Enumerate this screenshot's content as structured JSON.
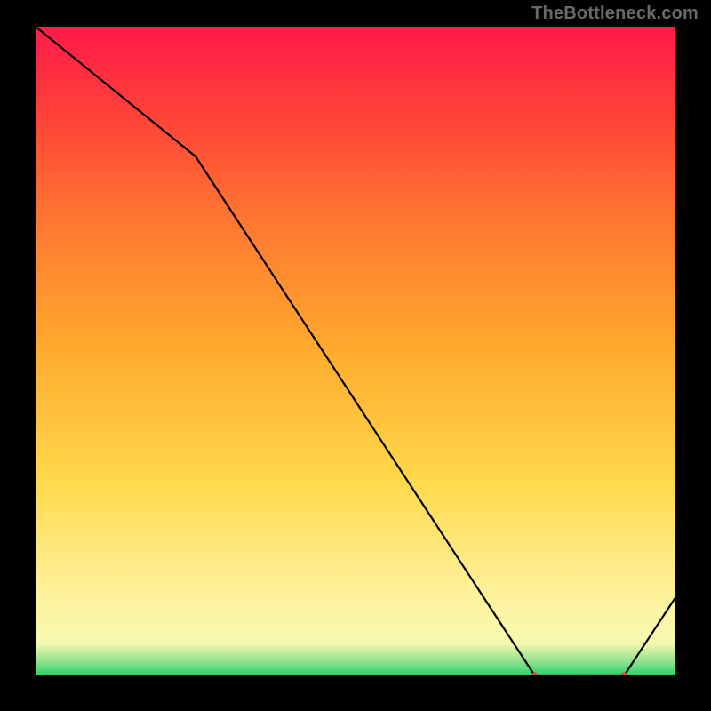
{
  "attribution": "TheBottleneck.com",
  "chart_data": {
    "type": "line",
    "title": "",
    "xlabel": "",
    "ylabel": "",
    "xlim": [
      0,
      100
    ],
    "ylim": [
      0,
      100
    ],
    "x": [
      0,
      25,
      78,
      82,
      92,
      100
    ],
    "values": [
      100,
      80,
      0,
      0,
      0,
      12
    ],
    "flat_segment": {
      "x_start": 78,
      "x_end": 92,
      "y": 0
    },
    "gradient_stops": [
      {
        "offset": 0.0,
        "color": "#22d36b"
      },
      {
        "offset": 0.02,
        "color": "#8be08a"
      },
      {
        "offset": 0.05,
        "color": "#f7f9b0"
      },
      {
        "offset": 0.13,
        "color": "#fef19a"
      },
      {
        "offset": 0.3,
        "color": "#ffd94a"
      },
      {
        "offset": 0.5,
        "color": "#ffab2e"
      },
      {
        "offset": 0.7,
        "color": "#ff7730"
      },
      {
        "offset": 0.86,
        "color": "#ff4338"
      },
      {
        "offset": 1.0,
        "color": "#ff1a49"
      }
    ],
    "line_color": "#000000",
    "marker_color": "#d14a3a"
  }
}
